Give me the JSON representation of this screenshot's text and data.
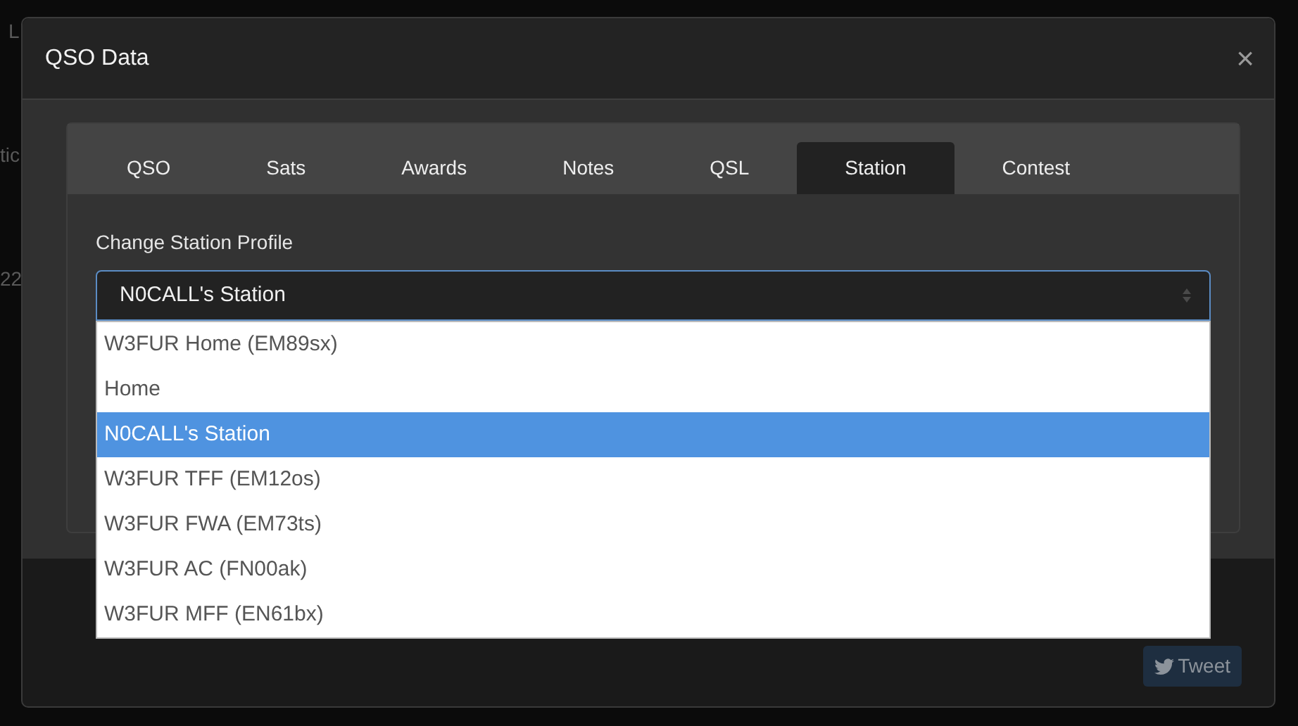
{
  "background_fragments": [
    "L",
    "tic",
    "22"
  ],
  "modal": {
    "title": "QSO Data",
    "close": "×"
  },
  "tabs": [
    {
      "label": "QSO",
      "selected": false
    },
    {
      "label": "Sats",
      "selected": false
    },
    {
      "label": "Awards",
      "selected": false
    },
    {
      "label": "Notes",
      "selected": false
    },
    {
      "label": "QSL",
      "selected": false
    },
    {
      "label": "Station",
      "selected": true
    },
    {
      "label": "Contest",
      "selected": false
    }
  ],
  "station_select": {
    "label": "Change Station Profile",
    "value": "N0CALL's Station",
    "expanded": true,
    "options": [
      {
        "label": "W3FUR Home (EM89sx)",
        "selected": false
      },
      {
        "label": "Home",
        "selected": false
      },
      {
        "label": "N0CALL's Station",
        "selected": true
      },
      {
        "label": "W3FUR TFF (EM12os)",
        "selected": false
      },
      {
        "label": "W3FUR FWA (EM73ts)",
        "selected": false
      },
      {
        "label": "W3FUR AC (FN00ak)",
        "selected": false
      },
      {
        "label": "W3FUR MFF (EN61bx)",
        "selected": false
      }
    ]
  },
  "footer": {
    "tweet_button": "Tweet"
  }
}
